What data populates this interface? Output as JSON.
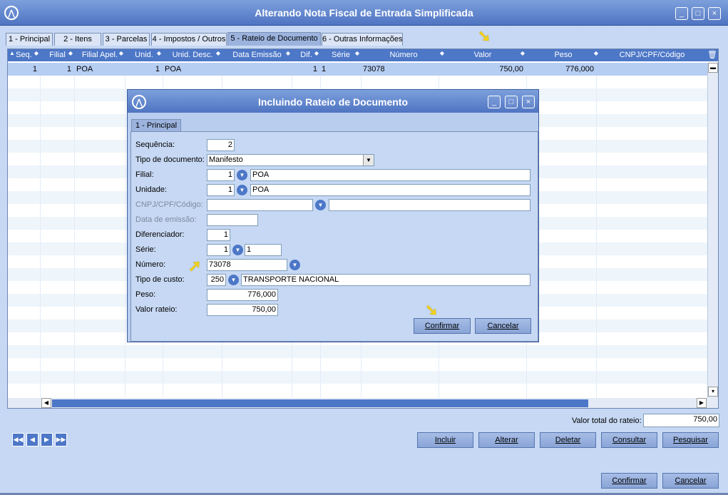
{
  "window": {
    "title": "Alterando Nota Fiscal de Entrada Simplificada",
    "logo": "logo-icon",
    "controls": [
      "minimize-icon",
      "maximize-icon",
      "close-icon"
    ]
  },
  "tabs": [
    {
      "label": "1 - Principal"
    },
    {
      "label": "2 - Itens"
    },
    {
      "label": "3 - Parcelas"
    },
    {
      "label": "4 - Impostos / Outros"
    },
    {
      "label": "5 - Rateio de Documento",
      "active": true
    },
    {
      "label": "6 - Outras Informações"
    }
  ],
  "grid": {
    "columns": [
      "Seq.",
      "Filial",
      "Filial Apel.",
      "Unid.",
      "Unid. Desc.",
      "Data Emissão",
      "Dif.",
      "Série",
      "Número",
      "Valor",
      "Peso",
      "CNPJ/CPF/Código"
    ],
    "rows": [
      {
        "seq": "1",
        "filial": "1",
        "filial_apel": "POA",
        "unid": "1",
        "unid_desc": "POA",
        "data_emissao": "",
        "dif": "1",
        "serie": "1",
        "numero": "73078",
        "valor": "750,00",
        "peso": "776,000",
        "cnpj": ""
      }
    ]
  },
  "dialog": {
    "title": "Incluindo Rateio de Documento",
    "tab": "1 - Principal",
    "fields": {
      "sequencia": {
        "label": "Sequência:",
        "value": "2"
      },
      "tipo_documento": {
        "label": "Tipo de documento:",
        "value": "Manifesto"
      },
      "filial": {
        "label": "Filial:",
        "code": "1",
        "desc": "POA"
      },
      "unidade": {
        "label": "Unidade:",
        "code": "1",
        "desc": "POA"
      },
      "cnpj": {
        "label": "CNPJ/CPF/Código:",
        "value": "",
        "desc": ""
      },
      "data_emissao": {
        "label": "Data de emissão:",
        "value": ""
      },
      "diferenciador": {
        "label": "Diferenciador:",
        "value": "1"
      },
      "serie": {
        "label": "Série:",
        "code": "1",
        "value": "1"
      },
      "numero": {
        "label": "Número:",
        "value": "73078"
      },
      "tipo_custo": {
        "label": "Tipo de custo:",
        "code": "250",
        "desc": "TRANSPORTE NACIONAL"
      },
      "peso": {
        "label": "Peso:",
        "value": "776,000"
      },
      "valor_rateio": {
        "label": "Valor rateio:",
        "value": "750,00"
      }
    },
    "confirm_label": "Confirmar",
    "cancel_label": "Cancelar"
  },
  "footer": {
    "total_label": "Valor total do rateio:",
    "total_value": "750,00",
    "nav": [
      "first-icon",
      "prev-icon",
      "next-icon",
      "last-icon"
    ],
    "buttons": {
      "incluir": "Incluir",
      "alterar": "Alterar",
      "deletar": "Deletar",
      "consultar": "Consultar",
      "pesquisar": "Pesquisar",
      "confirmar": "Confirmar",
      "cancelar": "Cancelar"
    }
  },
  "colors": {
    "title_bar": "#4f74c2",
    "grid_header": "#4d77c7",
    "selection": "#b7cef3",
    "highlight_arrow": "#f2d11b"
  }
}
